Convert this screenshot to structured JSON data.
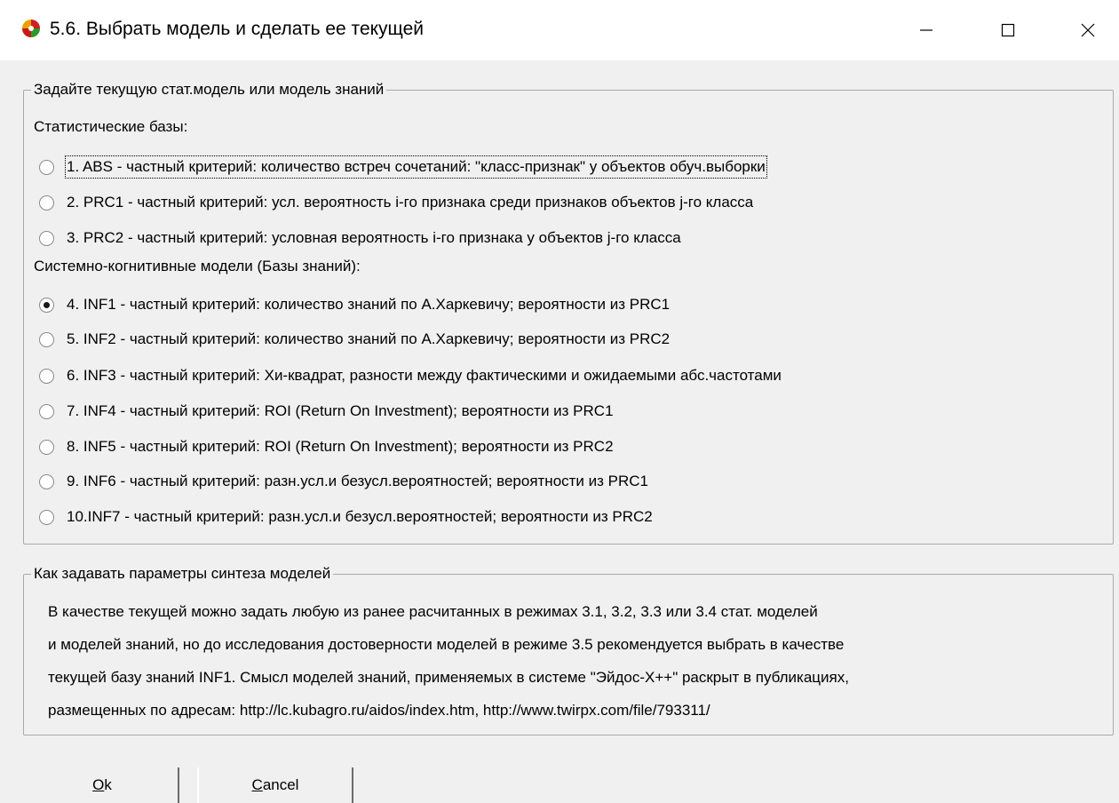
{
  "window": {
    "title": "5.6. Выбрать модель и сделать ее текущей"
  },
  "model_group": {
    "legend": "Задайте текущую стат.модель или модель знаний",
    "stat_section_label": "Статистические базы:",
    "knowledge_section_label": "Системно-когнитивные модели (Базы знаний):",
    "options": [
      {
        "label": "1. ABS  - частный критерий: количество встреч сочетаний: \"класс-признак\" у объектов обуч.выборки",
        "checked": false
      },
      {
        "label": "2. PRC1 - частный критерий: усл. вероятность i-го признака среди признаков объектов j-го класса",
        "checked": false
      },
      {
        "label": "3. PRC2 - частный критерий: условная вероятность i-го признака у объектов j-го класса",
        "checked": false
      },
      {
        "label": "4. INF1 - частный критерий: количество знаний по А.Харкевичу; вероятности из PRC1",
        "checked": true
      },
      {
        "label": "5. INF2 - частный критерий: количество знаний по А.Харкевичу; вероятности из PRC2",
        "checked": false
      },
      {
        "label": "6. INF3 - частный критерий: Хи-квадрат, разности между фактическими и ожидаемыми абс.частотами",
        "checked": false
      },
      {
        "label": "7. INF4 - частный критерий: ROI (Return On Investment); вероятности из PRC1",
        "checked": false
      },
      {
        "label": "8. INF5 - частный критерий: ROI (Return On Investment); вероятности из PRC2",
        "checked": false
      },
      {
        "label": "9. INF6 - частный критерий: разн.усл.и безусл.вероятностей; вероятности из PRC1",
        "checked": false
      },
      {
        "label": "10.INF7 - частный критерий: разн.усл.и безусл.вероятностей; вероятности из PRC2",
        "checked": false
      }
    ]
  },
  "info_group": {
    "legend": "Как задавать параметры синтеза моделей",
    "lines": [
      "В качестве текущей можно задать любую из ранее расчитанных в режимах 3.1, 3.2, 3.3 или 3.4 стат. моделей",
      "и моделей знаний, но до исследования достоверности моделей в режиме 3.5 рекомендуется выбрать в качестве",
      "текущей базу знаний INF1. Смысл моделей знаний, применяемых в системе \"Эйдос-X++\" раскрыт в публикациях,",
      "размещенных по адресам: http://lc.kubagro.ru/aidos/index.htm, http://www.twirpx.com/file/793311/"
    ]
  },
  "buttons": {
    "ok_mnemonic": "O",
    "ok_rest": "k",
    "cancel_mnemonic": "C",
    "cancel_rest": "ancel"
  }
}
